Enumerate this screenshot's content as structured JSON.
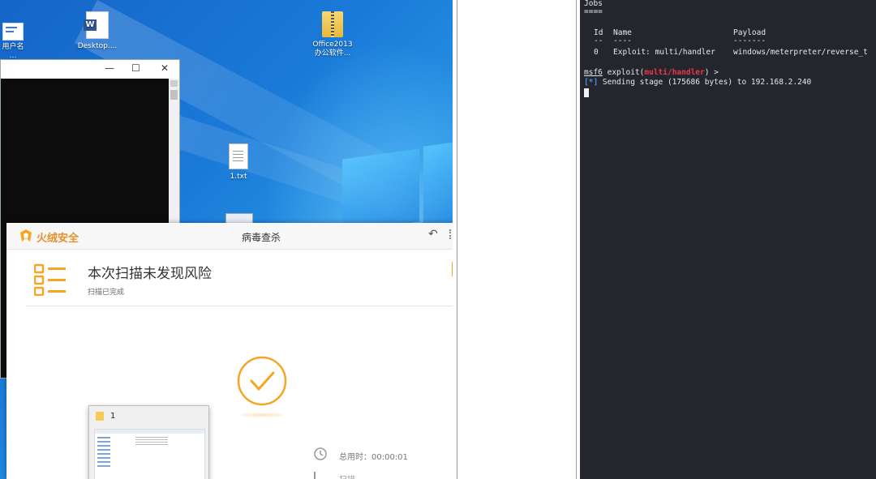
{
  "desktop": {
    "icons": [
      {
        "label_line1": "用户名",
        "label_line2": "…",
        "name": "user-folder-icon"
      },
      {
        "label_line1": "Desktop....",
        "name": "word-document-icon"
      },
      {
        "label_line1": "Office2013",
        "label_line2": "办公软件...",
        "name": "zip-archive-icon"
      },
      {
        "label_line1": "1.txt",
        "name": "text-file-icon"
      }
    ]
  },
  "cmd_window": {
    "minimize": "—",
    "maximize": "☐",
    "close": "✕"
  },
  "antivirus": {
    "brand": "火绒安全",
    "title": "病毒查杀",
    "back_icon": "↶",
    "result_title": "本次扫描未发现风险",
    "result_subtitle": "扫描已完成",
    "elapsed_label": "总用时：00:00:01",
    "scanned_label": "扫描…",
    "accent": "#f5a623"
  },
  "explorer_thumb": {
    "title": "1"
  },
  "terminal": {
    "jobs_header": "Jobs",
    "jobs_underline": "====",
    "col_id": "Id",
    "col_name": "Name",
    "col_payload": "Payload",
    "col_id_ul": "--",
    "col_name_ul": "----",
    "col_payload_ul": "-------",
    "row_id": "0",
    "row_name": "Exploit: multi/handler",
    "row_payload": "windows/meterpreter/reverse_t",
    "prompt_prefix": "msf6",
    "prompt_mid": " exploit(",
    "prompt_module": "multi/handler",
    "prompt_end": ") >",
    "status_tag": "[*]",
    "status_msg": " Sending stage (175686 bytes) to 192.168.2.240",
    "colors": {
      "module": "#e8364a",
      "status_tag": "#4a90e2",
      "prompt": "#e8e8e8"
    }
  }
}
